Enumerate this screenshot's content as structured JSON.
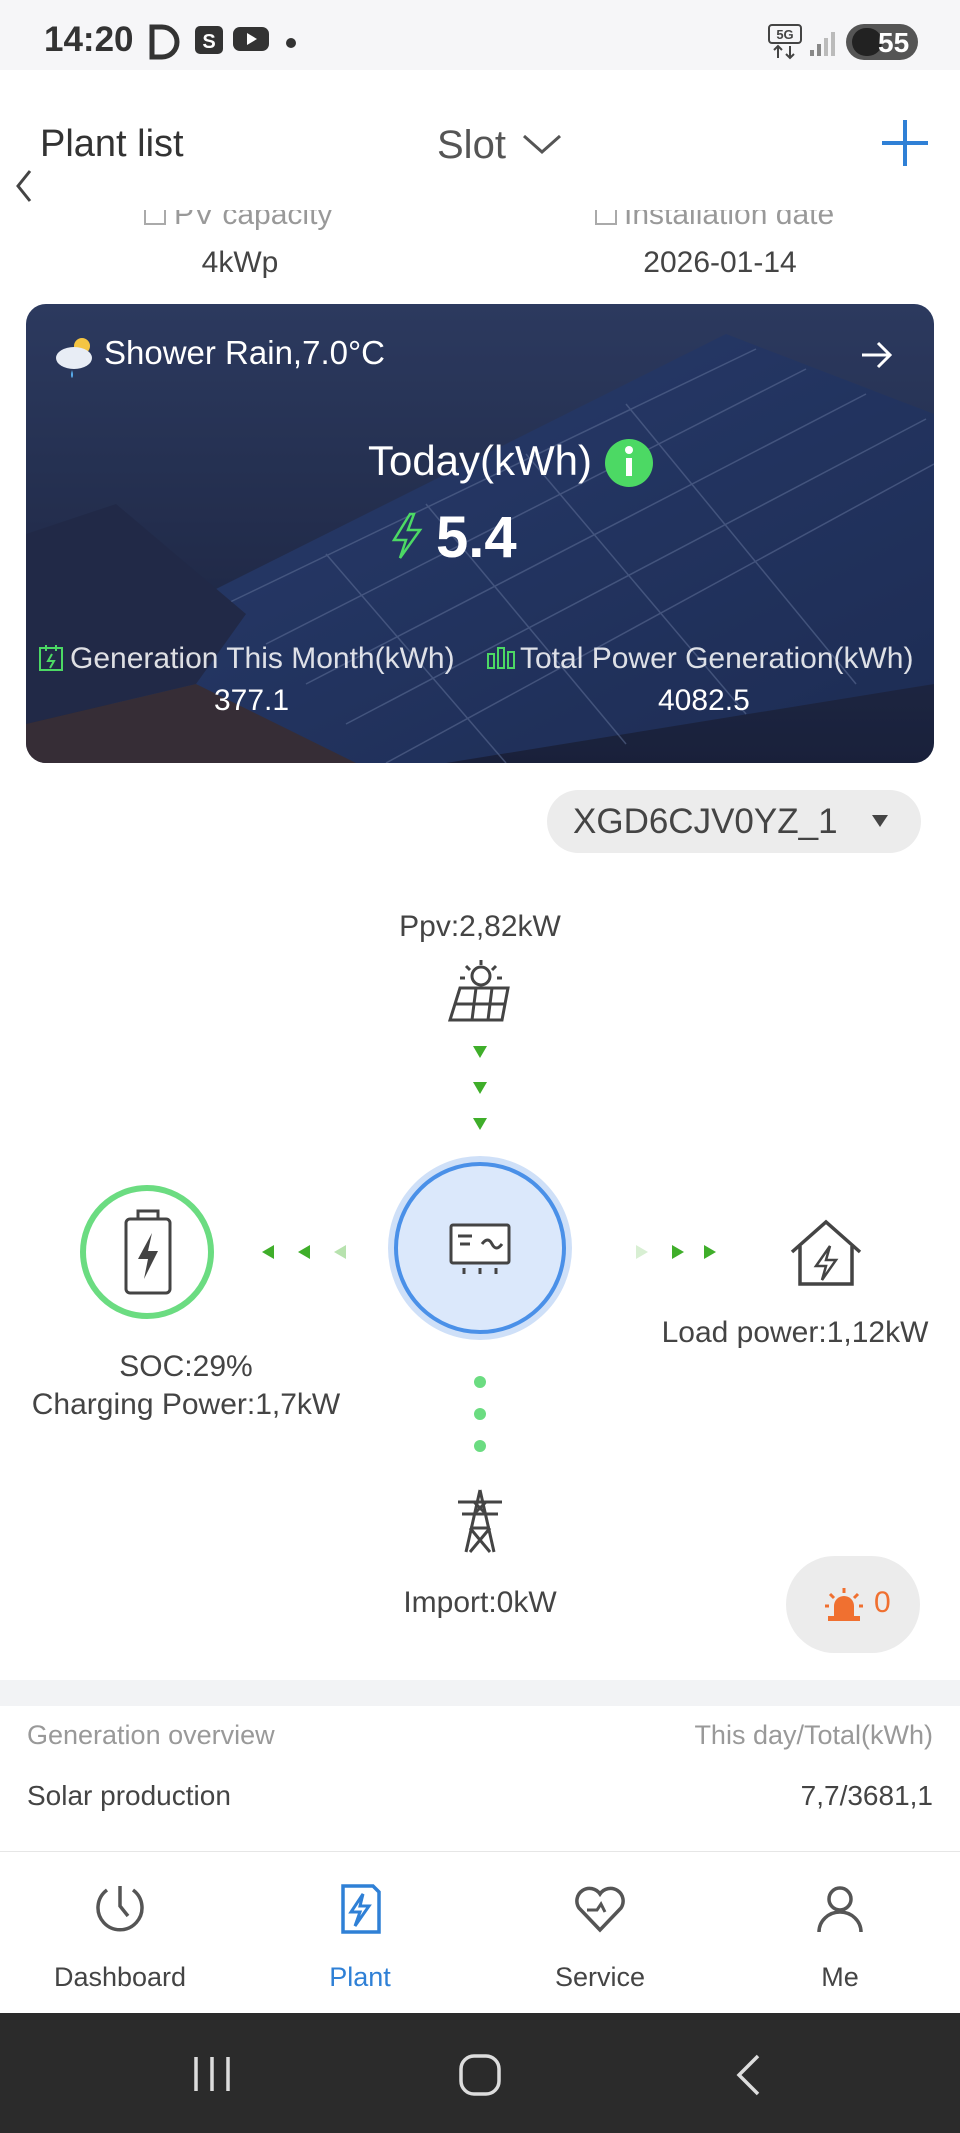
{
  "status_bar": {
    "time": "14:20",
    "network": "5G",
    "battery": "55"
  },
  "header": {
    "back_label": "Plant list",
    "plant_name": "Slot"
  },
  "plant_info": {
    "pv_capacity_label": "PV capacity",
    "pv_capacity_value": "4kWp",
    "installation_date_label": "Installation date",
    "installation_date_value": "2026-01-14"
  },
  "hero": {
    "weather": "Shower Rain,7.0°C",
    "today_label": "Today(kWh)",
    "today_value": "5.4",
    "month_label": "Generation This Month(kWh)",
    "month_value": "377.1",
    "total_label": "Total Power Generation(kWh)",
    "total_value": "4082.5"
  },
  "device": {
    "serial": "XGD6CJV0YZ_1"
  },
  "flow": {
    "pv": "Ppv:2,82kW",
    "soc": "SOC:29%",
    "charging": "Charging Power:1,7kW",
    "load": "Load power:1,12kW",
    "grid": "Import:0kW",
    "alarm_count": "0"
  },
  "overview": {
    "title": "Generation overview",
    "unit_label": "This day/Total(kWh)",
    "rows": [
      {
        "label": "Solar production",
        "value": "7,7/3681,1"
      }
    ]
  },
  "tabs": [
    {
      "label": "Dashboard",
      "icon": "dashboard-icon"
    },
    {
      "label": "Plant",
      "icon": "plant-icon"
    },
    {
      "label": "Service",
      "icon": "service-icon"
    },
    {
      "label": "Me",
      "icon": "me-icon"
    }
  ],
  "colors": {
    "accent": "#2f80d6",
    "green": "#4cd964",
    "flow_green": "#3fae2a",
    "alarm": "#f07030"
  }
}
